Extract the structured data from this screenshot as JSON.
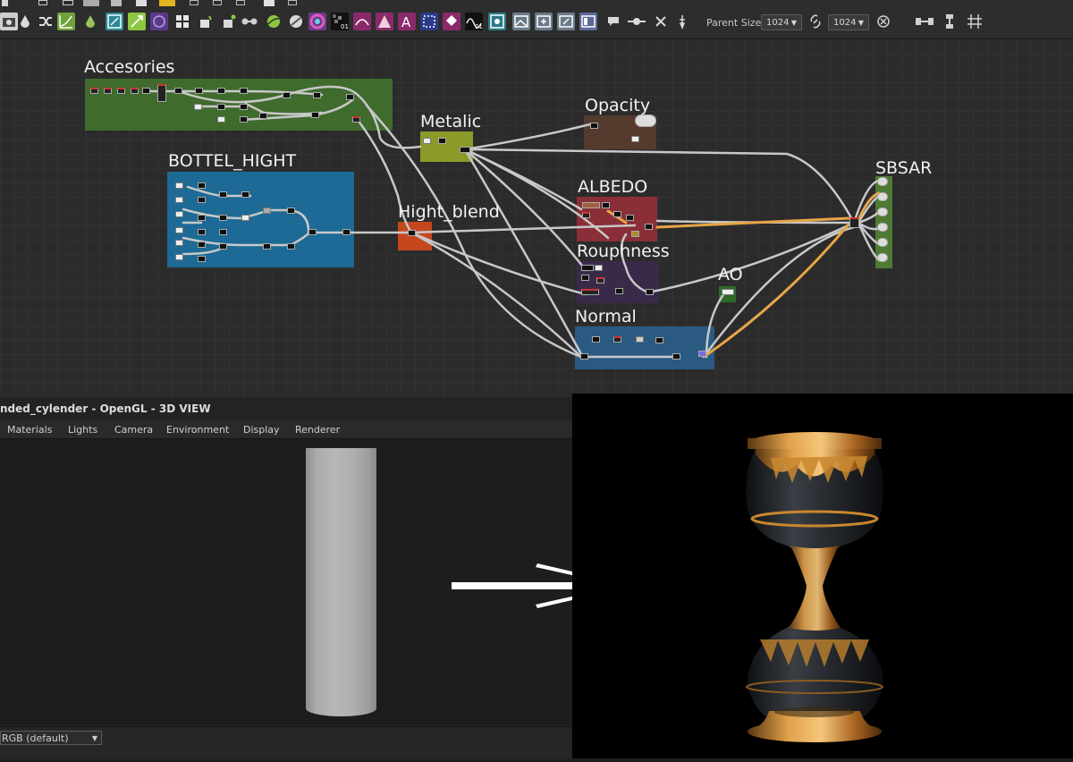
{
  "toolbar": {
    "icons": [
      "camera-icon",
      "pen-icon",
      "magnifier-icon",
      "import-icon",
      "export-icon",
      "bitmap-icon",
      "bus-icon",
      "fill-icon",
      "droplet-icon",
      "shuffle-icon",
      "curve-icon",
      "gradient-map-icon",
      "normal-icon",
      "transform-icon",
      "ellipse-icon",
      "grid-icon",
      "bucket-icon",
      "paint-icon",
      "connector-icon",
      "sphere-icon",
      "color-wheel-icon",
      "noise-01-icon",
      "curve-node-icon",
      "triangle-icon",
      "text-icon",
      "selection-icon",
      "bucket-select-icon",
      "pattern-01-icon",
      "graph-icon",
      "image-icon",
      "image-add-icon",
      "image-edit-icon",
      "frame-icon",
      "comment-icon",
      "pin-icon",
      "cross-icon",
      "pen-tool-icon"
    ],
    "parent_size_label": "Parent Size:",
    "width_value": "1024",
    "height_value": "1024",
    "right_icons": [
      "link-icon",
      "reset-icon",
      "align-h-icon",
      "align-v-icon",
      "align-grid-icon"
    ]
  },
  "graph": {
    "frames": [
      {
        "name": "accesories",
        "title": "Accesories",
        "color": "#3f6b2c"
      },
      {
        "name": "bottel-hight",
        "title": "BOTTEL_HIGHT",
        "color": "#1c6a95"
      },
      {
        "name": "metalic",
        "title": "Metalic",
        "color": "#8c9a2a"
      },
      {
        "name": "hight-blend",
        "title": "Hight_blend",
        "color": "#c4471e"
      },
      {
        "name": "opacity",
        "title": "Opacity",
        "color": "#553a2e"
      },
      {
        "name": "albedo",
        "title": "ALBEDO",
        "color": "#8a2f38"
      },
      {
        "name": "rouphness",
        "title": "Rouphness",
        "color": "#3a2a4a"
      },
      {
        "name": "ao",
        "title": "AO",
        "color": "#2e6a2a"
      },
      {
        "name": "normal",
        "title": "Normal",
        "color": "#2a5a82"
      },
      {
        "name": "sbsar",
        "title": "SBSAR",
        "color": "#4f7a33"
      }
    ],
    "wire_color": "#c8c8c8",
    "highlight_wire_color": "#e6a545"
  },
  "viewport": {
    "title": "nded_cylender - OpenGL - 3D VIEW",
    "menus": [
      "Materials",
      "Lights",
      "Camera",
      "Environment",
      "Display",
      "Renderer"
    ],
    "color_mode": "RGB (default)"
  },
  "render": {
    "body_color": "#262a2e",
    "gold_color": "#c9872e"
  }
}
